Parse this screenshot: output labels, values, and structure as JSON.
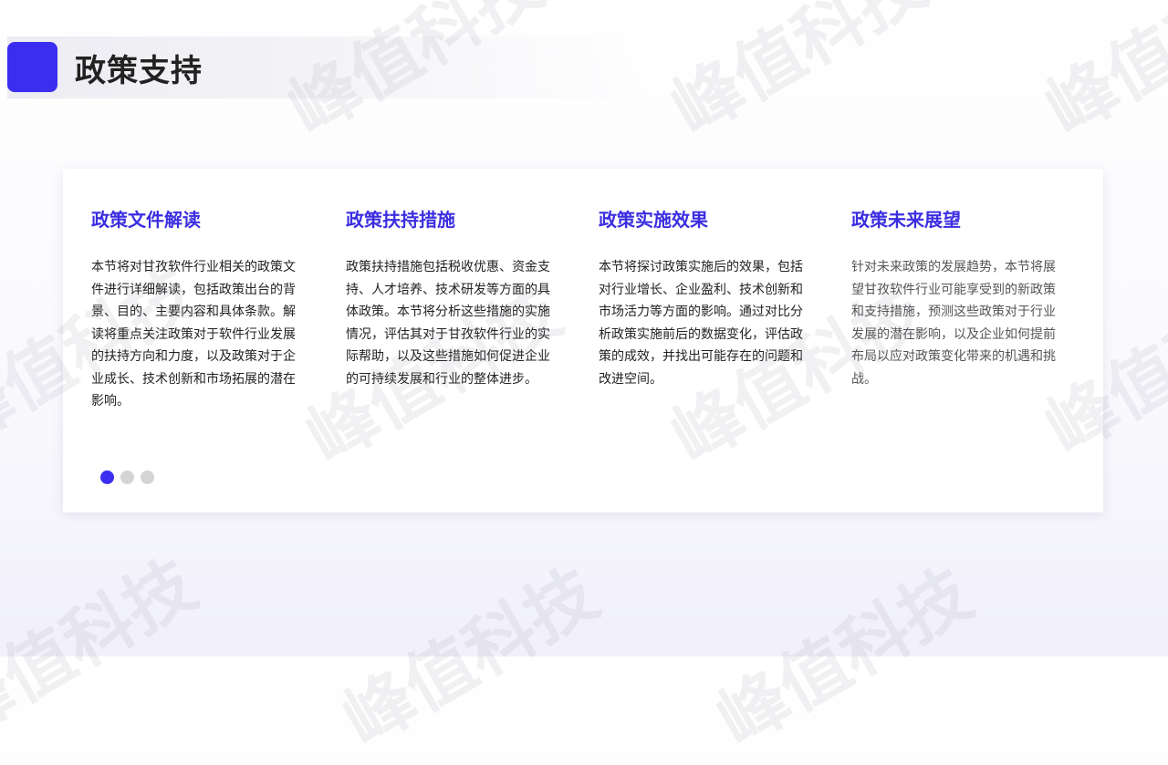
{
  "page": {
    "title": "政策支持"
  },
  "sections": [
    {
      "heading": "政策文件解读",
      "body": "本节将对甘孜软件行业相关的政策文件进行详细解读，包括政策出台的背景、目的、主要内容和具体条款。解读将重点关注政策对于软件行业发展的扶持方向和力度，以及政策对于企业成长、技术创新和市场拓展的潜在影响。"
    },
    {
      "heading": "政策扶持措施",
      "body": "政策扶持措施包括税收优惠、资金支持、人才培养、技术研发等方面的具体政策。本节将分析这些措施的实施情况，评估其对于甘孜软件行业的实际帮助，以及这些措施如何促进企业的可持续发展和行业的整体进步。"
    },
    {
      "heading": "政策实施效果",
      "body": "本节将探讨政策实施后的效果，包括对行业增长、企业盈利、技术创新和市场活力等方面的影响。通过对比分析政策实施前后的数据变化，评估政策的成效，并找出可能存在的问题和改进空间。"
    },
    {
      "heading": "政策未来展望",
      "body": "针对未来政策的发展趋势，本节将展望甘孜软件行业可能享受到的新政策和支持措施，预测这些政策对于行业发展的潜在影响，以及企业如何提前布局以应对政策变化带来的机遇和挑战。"
    }
  ],
  "watermark": {
    "text": "峰值科技"
  },
  "carousel": {
    "current": 1,
    "total": 3
  },
  "colors": {
    "accent": "#3b2ef0",
    "heading": "#3b2ee0"
  }
}
